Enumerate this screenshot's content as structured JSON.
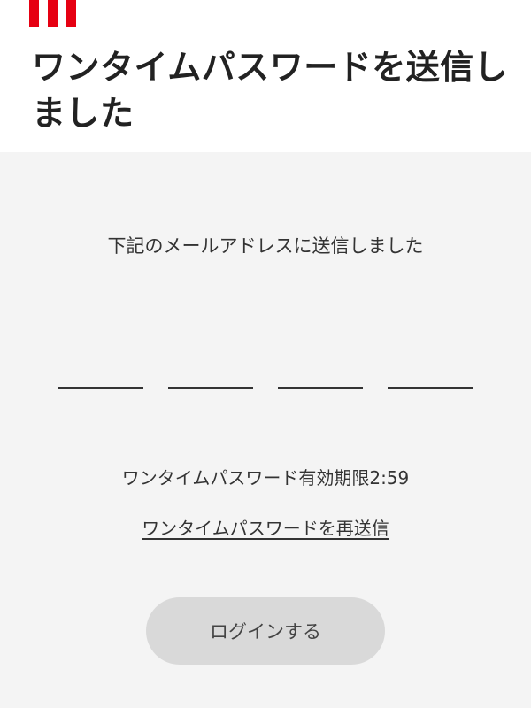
{
  "header": {
    "title": "ワンタイムパスワードを送信しました",
    "logo": {
      "color": "#e60012"
    }
  },
  "main": {
    "description": "下記のメールアドレスに送信しました",
    "otp_fields": [
      "",
      "",
      "",
      ""
    ],
    "expiry_label": "ワンタイムパスワード有効期限",
    "expiry_time": "2:59",
    "resend_link": "ワンタイムパスワードを再送信",
    "login_button": "ログインする"
  },
  "colors": {
    "panel_background": "#f4f4f4",
    "button_background": "#d9d9d9"
  }
}
